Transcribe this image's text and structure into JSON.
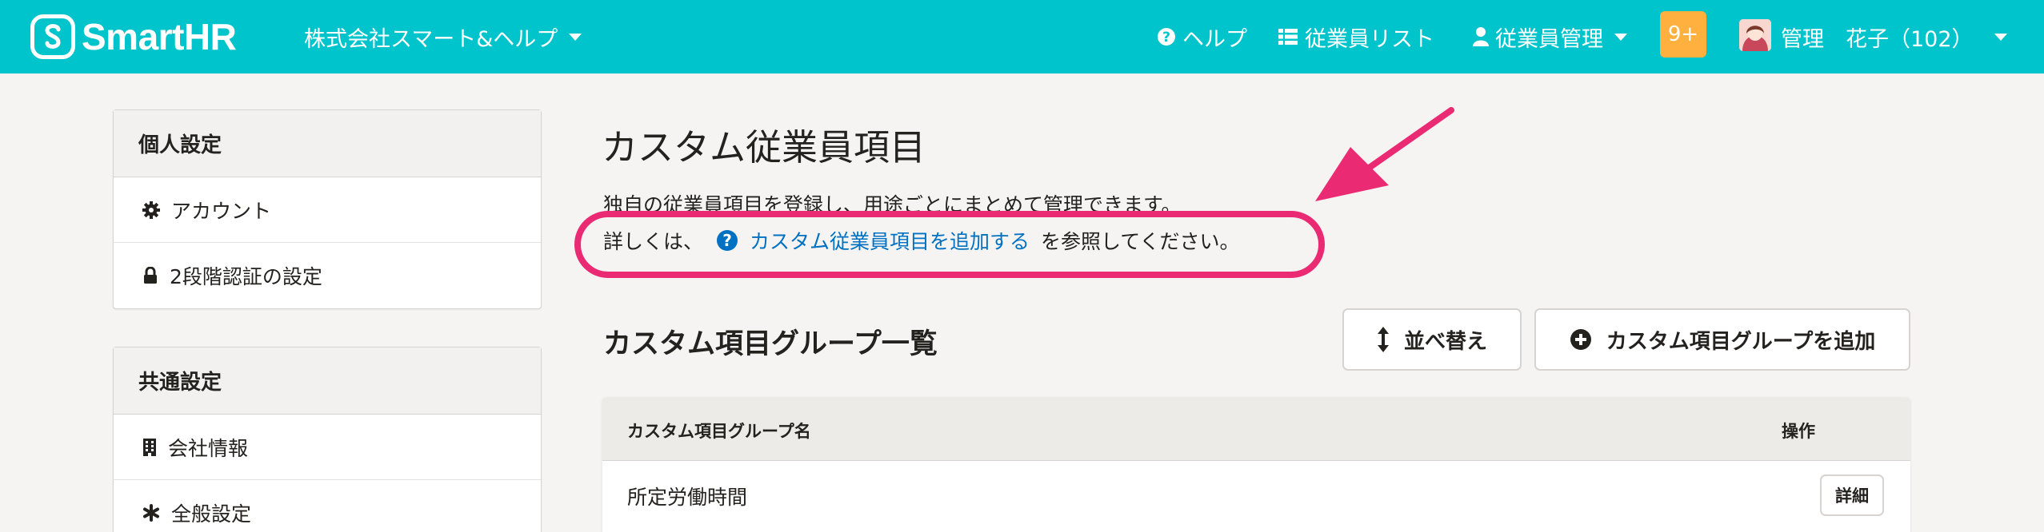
{
  "header": {
    "logo_text": "SmartHR",
    "company": "株式会社スマート&ヘルプ",
    "help": "ヘルプ",
    "employee_list": "従業員リスト",
    "employee_mgmt": "従業員管理",
    "notification_count": "9+",
    "user": "管理　花子（102）",
    "bg_color": "#00c4cc"
  },
  "sidebar": {
    "personal": {
      "title": "個人設定",
      "items": [
        {
          "icon": "gear-icon",
          "label": "アカウント"
        },
        {
          "icon": "lock-icon",
          "label": "2段階認証の設定"
        }
      ]
    },
    "common": {
      "title": "共通設定",
      "items": [
        {
          "icon": "building-icon",
          "label": "会社情報"
        },
        {
          "icon": "asterisk-icon",
          "label": "全般設定"
        }
      ]
    }
  },
  "main": {
    "title": "カスタム従業員項目",
    "description_line1": "独自の従業員項目を登録し、用途ごとにまとめて管理できます。",
    "description_prefix": "詳しくは、",
    "help_link": "カスタム従業員項目を追加する",
    "description_suffix": "を参照してください。",
    "section_title": "カスタム項目グループ一覧",
    "sort_button": "並べ替え",
    "add_group_button": "カスタム項目グループを追加",
    "table": {
      "col_name": "カスタム項目グループ名",
      "col_actions": "操作",
      "rows": [
        {
          "name": "所定労働時間",
          "action": "詳細"
        }
      ]
    }
  },
  "annotation_color": "#ea2a73"
}
